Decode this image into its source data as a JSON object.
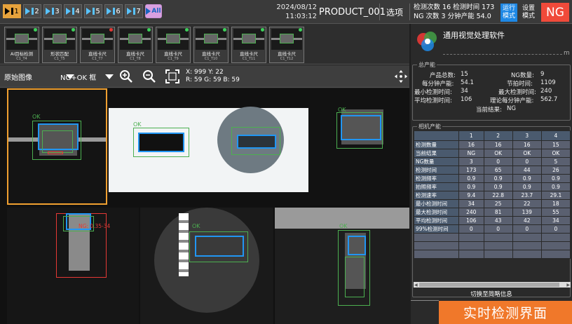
{
  "top": {
    "cam_tabs": [
      "1",
      "2",
      "3",
      "4",
      "5",
      "6",
      "7"
    ],
    "all_label": "All",
    "date": "2024/08/12",
    "time": "11:03:12",
    "product": "PRODUCT_001",
    "options": "选项",
    "stats_line1": "检测次数 16   检测时间 173",
    "stats_line2": "NG 次数 3     分钟产能 54.0",
    "run_mode_1": "运行",
    "run_mode_2": "模式",
    "set_mode_1": "设置",
    "set_mode_2": "模式",
    "result_badge": "NG"
  },
  "tools": [
    {
      "label": "AI目标检测",
      "sub": "C1_T4",
      "status": "ok"
    },
    {
      "label": "形状匹配",
      "sub": "C1_T5",
      "status": "ok"
    },
    {
      "label": "直线卡尺",
      "sub": "C1_T7",
      "status": "ng"
    },
    {
      "label": "直线卡尺",
      "sub": "C1_T8",
      "status": "ok"
    },
    {
      "label": "直线卡尺",
      "sub": "C1_T9",
      "status": "ok"
    },
    {
      "label": "直线卡尺",
      "sub": "C1_T10",
      "status": "ok"
    },
    {
      "label": "直线卡尺",
      "sub": "C1_T11",
      "status": "ok"
    },
    {
      "label": "直线卡尺",
      "sub": "C1_T12",
      "status": "ok"
    }
  ],
  "imgbar": {
    "image_source": "原始图像",
    "filter": "NG+OK 框",
    "coord_line1": "X: 999  Y: 22",
    "coord_line2": "R: 59 G: 59 B: 59"
  },
  "grid": {
    "ok": "OK",
    "ng_text": "NG: 0.35-34"
  },
  "panel": {
    "brand_title": "通用视觉处理软件",
    "brand_m": "m",
    "total_title": "总产能",
    "total_count_label": "产品总数:",
    "total_count": "15",
    "ng_count_label": "NG数量:",
    "ng_count": "9",
    "per_min_label": "每分钟产能:",
    "per_min": "54.1",
    "cycle_label": "节拍时间:",
    "cycle": "1109",
    "min_time_label": "最小检测时间:",
    "min_time": "34",
    "max_time_label": "最大检测时间:",
    "max_time": "240",
    "avg_time_label": "平均检测时间:",
    "avg_time": "106",
    "theory_label": "理论每分钟产能:",
    "theory": "562.7",
    "current_result_label": "当前结果:",
    "current_result": "NG",
    "camera_title": "相机产能",
    "cam_headers": [
      "",
      "1",
      "2",
      "3",
      "4"
    ],
    "cam_rows": [
      {
        "label": "检测数量",
        "values": [
          "16",
          "16",
          "16",
          "15"
        ]
      },
      {
        "label": "当前结果",
        "values": [
          "NG",
          "OK",
          "OK",
          "OK"
        ]
      },
      {
        "label": "NG数量",
        "values": [
          "3",
          "0",
          "0",
          "5"
        ]
      },
      {
        "label": "检测时间",
        "values": [
          "173",
          "65",
          "44",
          "26"
        ]
      },
      {
        "label": "检测频率",
        "values": [
          "0.9",
          "0.9",
          "0.9",
          "0.9"
        ]
      },
      {
        "label": "拍照频率",
        "values": [
          "0.9",
          "0.9",
          "0.9",
          "0.9"
        ]
      },
      {
        "label": "检测速率",
        "values": [
          "9.4",
          "22.8",
          "23.7",
          "29.1"
        ]
      },
      {
        "label": "最小检测时间",
        "values": [
          "34",
          "25",
          "22",
          "18"
        ]
      },
      {
        "label": "最大检测时间",
        "values": [
          "240",
          "81",
          "139",
          "55"
        ]
      },
      {
        "label": "平均检测时间",
        "values": [
          "106",
          "43",
          "42",
          "34"
        ]
      },
      {
        "label": "99%检测时间",
        "values": [
          "0",
          "0",
          "0",
          "0"
        ]
      }
    ],
    "switch_label": "切换至简略信息",
    "realtime_label": "实时检测界面"
  }
}
